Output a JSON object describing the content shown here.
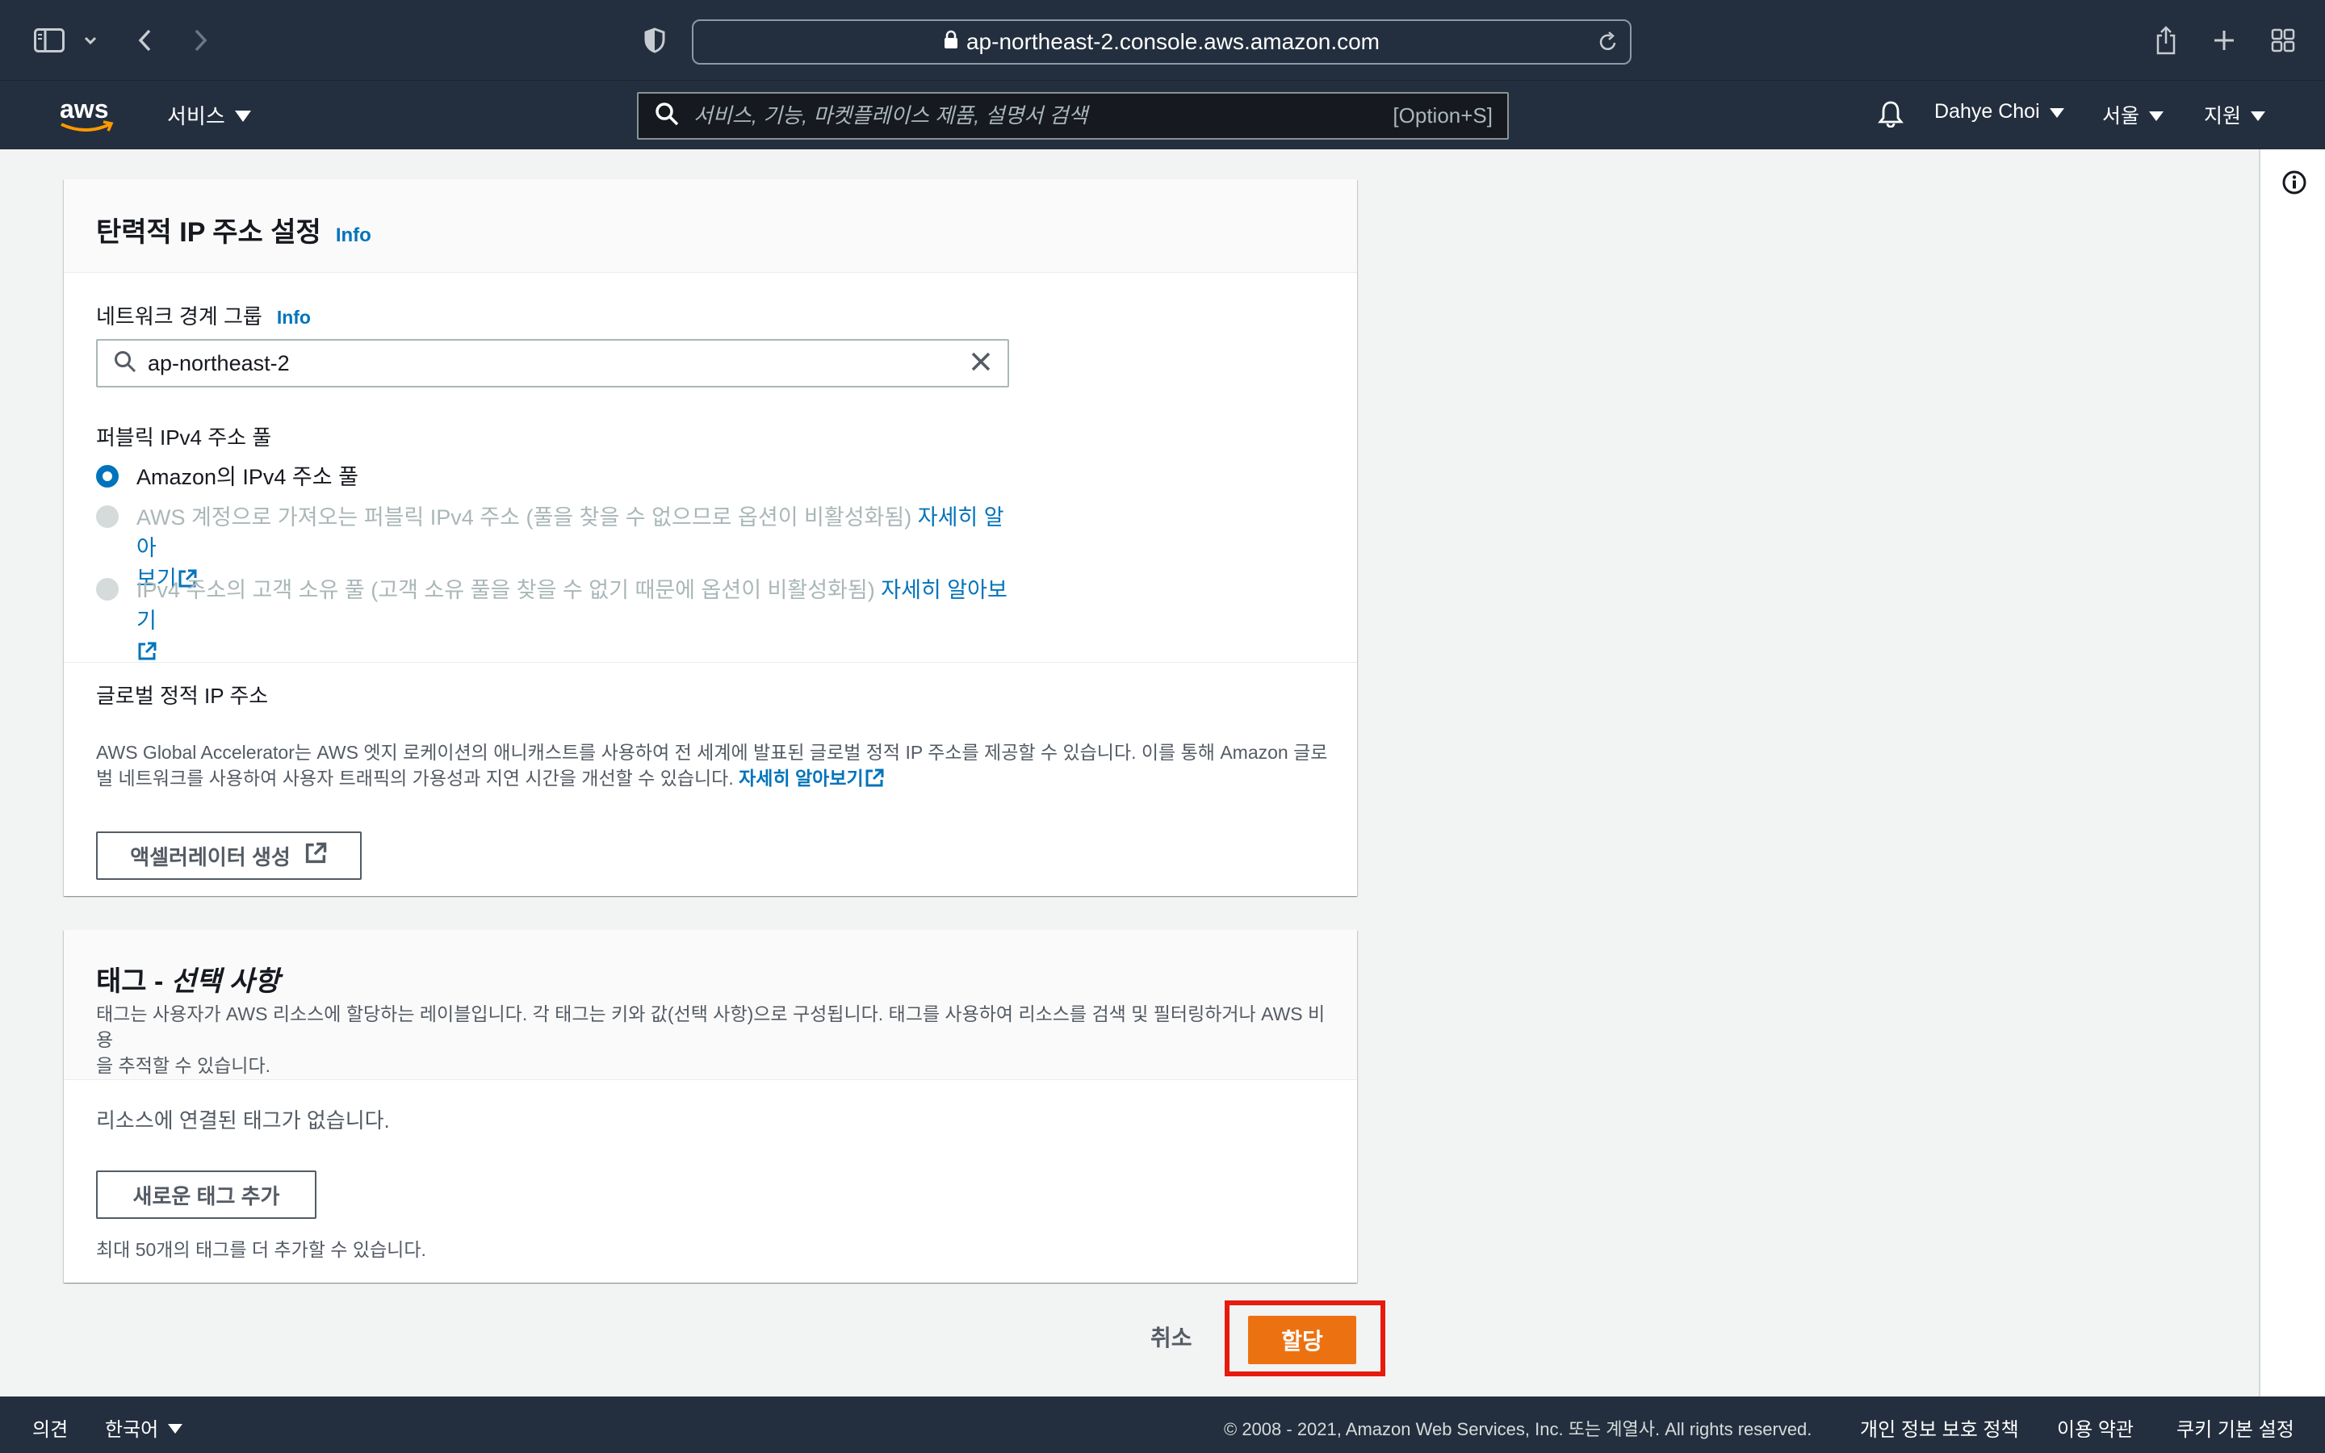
{
  "browser": {
    "url": "ap-northeast-2.console.aws.amazon.com"
  },
  "header": {
    "logo_text": "aws",
    "services_label": "서비스",
    "search_placeholder": "서비스, 기능, 마켓플레이스 제품, 설명서 검색",
    "search_shortcut": "[Option+S]",
    "user_label": "Dahye Choi",
    "region_label": "서울",
    "support_label": "지원"
  },
  "eip_settings": {
    "title": "탄력적 IP 주소 설정",
    "info_label": "Info",
    "network_border_group": {
      "label": "네트워크 경계 그룹",
      "info_label": "Info",
      "value": "ap-northeast-2"
    },
    "public_pool": {
      "label": "퍼블릭 IPv4 주소 풀",
      "options": [
        {
          "text": "Amazon의 IPv4 주소 풀",
          "selected": true,
          "disabled": false
        },
        {
          "text": "AWS 계정으로 가져오는 퍼블릭 IPv4 주소 (풀을 찾을 수 없으므로 옵션이 비활성화됨)",
          "link_text_1": "자세히 알아",
          "link_text_2": "보기",
          "selected": false,
          "disabled": true
        },
        {
          "text": "IPv4 주소의 고객 소유 풀 (고객 소유 풀을 찾을 수 없기 때문에 옵션이 비활성화됨)",
          "link_text": "자세히 알아보기",
          "selected": false,
          "disabled": true
        }
      ]
    },
    "global_static": {
      "label": "글로벌 정적 IP 주소",
      "description_line1": "AWS Global Accelerator는 AWS 엣지 로케이션의 애니캐스트를 사용하여 전 세계에 발표된 글로벌 정적 IP 주소를 제공할 수 있습니다. 이를 통해 Amazon 글로",
      "description_line2": "벌 네트워크를 사용하여 사용자 트래픽의 가용성과 지연 시간을 개선할 수 있습니다.",
      "link_text": "자세히 알아보기",
      "create_button": "액셀러레이터 생성"
    }
  },
  "tags": {
    "title_main": "태그 - ",
    "title_optional": "선택 사항",
    "description_line1": "태그는 사용자가 AWS 리소스에 할당하는 레이블입니다. 각 태그는 키와 값(선택 사항)으로 구성됩니다. 태그를 사용하여 리소스를 검색 및 필터링하거나 AWS 비용",
    "description_line2": "을 추적할 수 있습니다.",
    "empty_text": "리소스에 연결된 태그가 없습니다.",
    "add_button": "새로운 태그 추가",
    "limit_text": "최대 50개의 태그를 더 추가할 수 있습니다."
  },
  "actions": {
    "cancel": "취소",
    "allocate": "할당"
  },
  "footer": {
    "feedback": "의견",
    "language": "한국어",
    "copyright": "© 2008 - 2021, Amazon Web Services, Inc. 또는 계열사. All rights reserved.",
    "privacy": "개인 정보 보호 정책",
    "terms": "이용 약관",
    "cookies": "쿠키 기본 설정"
  },
  "colors": {
    "header_bg": "#232f3e",
    "link": "#0073bb",
    "primary": "#ec7211",
    "highlight": "#e8190d"
  }
}
